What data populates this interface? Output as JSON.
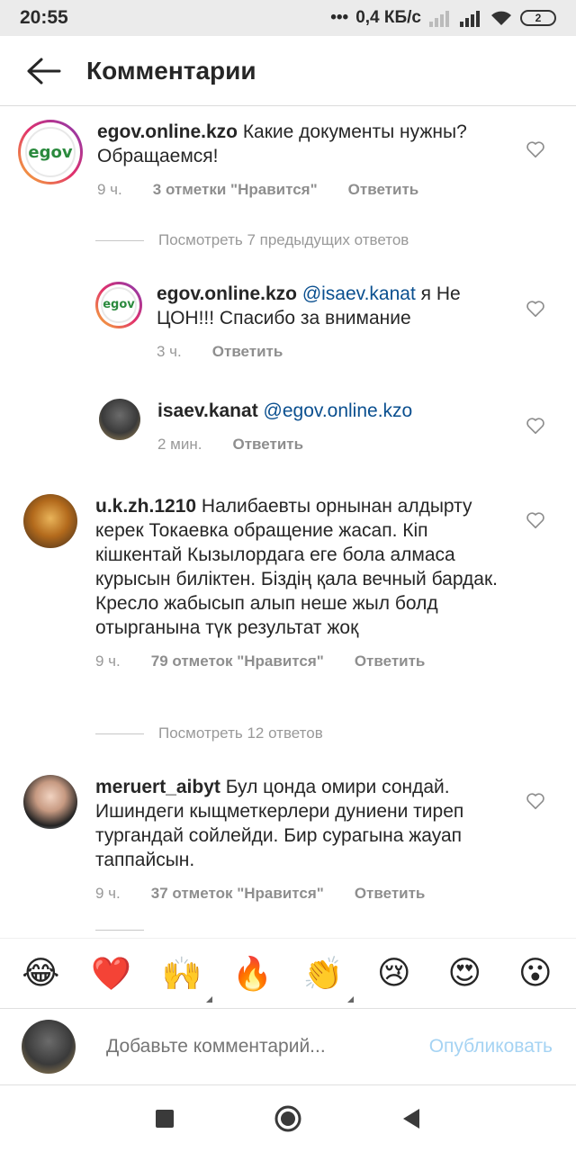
{
  "status_bar": {
    "time": "20:55",
    "network_speed": "0,4 КБ/с",
    "battery": "2"
  },
  "app_bar": {
    "title": "Комментарии"
  },
  "comments": [
    {
      "username": "egov.online.kzo",
      "text": "Какие документы нужны? Обращаемся!",
      "time": "9 ч.",
      "likes": "3 отметки \"Нравится\"",
      "reply": "Ответить",
      "avatar_label": "egov"
    },
    {
      "username": "u.k.zh.1210",
      "text": "Налибаевты орнынан алдырту керек Токаевка обращение жасап. Кіп кішкентай Кызылордага еге бола алмаса курысын биліктен. Біздің қала вечный бардак. Кресло жабысып алып неше жыл болд отырганына түк результат жоқ",
      "time": "9 ч.",
      "likes": "79 отметок \"Нравится\"",
      "reply": "Ответить"
    },
    {
      "username": "meruert_aibyt",
      "text": "Бул цонда омири сондай. Ишиндеги кыщметкерлери дуниени тиреп тургандай сойлейди. Бир сурагына жауап таппайсын.",
      "time": "9 ч.",
      "likes": "37 отметок \"Нравится\"",
      "reply": "Ответить"
    }
  ],
  "view_replies": [
    "Посмотреть 7 предыдущих ответов",
    "Посмотреть 12 ответов"
  ],
  "replies": [
    {
      "username": "egov.online.kzo",
      "mention": "@isaev.kanat",
      "text": "я Не ЦОН!!! Спасибо за внимание",
      "time": "3 ч.",
      "reply": "Ответить",
      "avatar_label": "egov"
    },
    {
      "username": "isaev.kanat",
      "mention": "@egov.online.kzo",
      "text": "",
      "time": "2 мин.",
      "reply": "Ответить"
    }
  ],
  "emojis": [
    "😂",
    "❤️",
    "🙌",
    "🔥",
    "👏",
    "😢",
    "😍",
    "😮"
  ],
  "comment_input": {
    "placeholder": "Добавьте комментарий...",
    "publish_label": "Опубликовать"
  }
}
